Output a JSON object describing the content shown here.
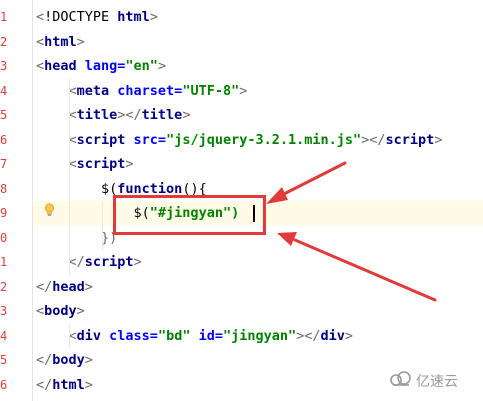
{
  "editor": {
    "line_numbers": [
      "1",
      "2",
      "3",
      "4",
      "5",
      "6",
      "7",
      "8",
      "9",
      "0",
      "1",
      "2",
      "3",
      "4",
      "5",
      "6"
    ],
    "lines": [
      [
        {
          "t": "<",
          "c": "punct"
        },
        {
          "t": "!DOCTYPE ",
          "c": "plain"
        },
        {
          "t": "html",
          "c": "tag"
        },
        {
          "t": ">",
          "c": "punct"
        }
      ],
      [
        {
          "t": "<",
          "c": "punct"
        },
        {
          "t": "html",
          "c": "tag"
        },
        {
          "t": ">",
          "c": "punct"
        }
      ],
      [
        {
          "t": "<",
          "c": "punct"
        },
        {
          "t": "head ",
          "c": "tag"
        },
        {
          "t": "lang=",
          "c": "attr"
        },
        {
          "t": "\"en\"",
          "c": "str"
        },
        {
          "t": ">",
          "c": "punct"
        }
      ],
      [
        {
          "t": "    <",
          "c": "punct"
        },
        {
          "t": "meta ",
          "c": "tag"
        },
        {
          "t": "charset=",
          "c": "attr"
        },
        {
          "t": "\"UTF-8\"",
          "c": "str"
        },
        {
          "t": ">",
          "c": "punct"
        }
      ],
      [
        {
          "t": "    <",
          "c": "punct"
        },
        {
          "t": "title",
          "c": "tag"
        },
        {
          "t": "></",
          "c": "punct"
        },
        {
          "t": "title",
          "c": "tag"
        },
        {
          "t": ">",
          "c": "punct"
        }
      ],
      [
        {
          "t": "    <",
          "c": "punct"
        },
        {
          "t": "script ",
          "c": "tag"
        },
        {
          "t": "src=",
          "c": "attr"
        },
        {
          "t": "\"js/jquery-3.2.1.min.js\"",
          "c": "str"
        },
        {
          "t": "></",
          "c": "punct"
        },
        {
          "t": "script",
          "c": "tag"
        },
        {
          "t": ">",
          "c": "punct"
        }
      ],
      [
        {
          "t": "    <",
          "c": "punct"
        },
        {
          "t": "script",
          "c": "tag"
        },
        {
          "t": ">",
          "c": "punct"
        }
      ],
      [
        {
          "t": "        $(",
          "c": "plain"
        },
        {
          "t": "function",
          "c": "kw"
        },
        {
          "t": "(){",
          "c": "plain"
        }
      ],
      [
        {
          "t": "            $(",
          "c": "plain"
        },
        {
          "t": "\"#jingyan",
          "c": "str"
        },
        {
          "t": "\")",
          "c": "str"
        }
      ],
      [
        {
          "t": "        })",
          "c": "punct"
        }
      ],
      [
        {
          "t": "    </",
          "c": "punct"
        },
        {
          "t": "script",
          "c": "tag"
        },
        {
          "t": ">",
          "c": "punct"
        }
      ],
      [
        {
          "t": "</",
          "c": "punct"
        },
        {
          "t": "head",
          "c": "tag"
        },
        {
          "t": ">",
          "c": "punct"
        }
      ],
      [
        {
          "t": "<",
          "c": "punct"
        },
        {
          "t": "body",
          "c": "tag"
        },
        {
          "t": ">",
          "c": "punct"
        }
      ],
      [
        {
          "t": "    <",
          "c": "punct"
        },
        {
          "t": "div ",
          "c": "tag"
        },
        {
          "t": "class=",
          "c": "attr"
        },
        {
          "t": "\"bd\" ",
          "c": "str"
        },
        {
          "t": "id=",
          "c": "attr"
        },
        {
          "t": "\"jingyan\"",
          "c": "str"
        },
        {
          "t": "></",
          "c": "punct"
        },
        {
          "t": "div",
          "c": "tag"
        },
        {
          "t": ">",
          "c": "punct"
        }
      ],
      [
        {
          "t": "</",
          "c": "punct"
        },
        {
          "t": "body",
          "c": "tag"
        },
        {
          "t": ">",
          "c": "punct"
        }
      ],
      [
        {
          "t": "</",
          "c": "punct"
        },
        {
          "t": "html",
          "c": "tag"
        },
        {
          "t": ">",
          "c": "punct"
        }
      ]
    ],
    "current_line_index": 8
  },
  "watermark": {
    "text": "亿速云"
  },
  "colors": {
    "annotation_red": "#e03a3a",
    "line_number": "#d9413b",
    "tag": "#000080",
    "attribute": "#0000ff",
    "string": "#008000"
  },
  "icons": {
    "gutter_hint": "lightbulb-icon",
    "watermark_logo": "cloud-logo-icon"
  }
}
